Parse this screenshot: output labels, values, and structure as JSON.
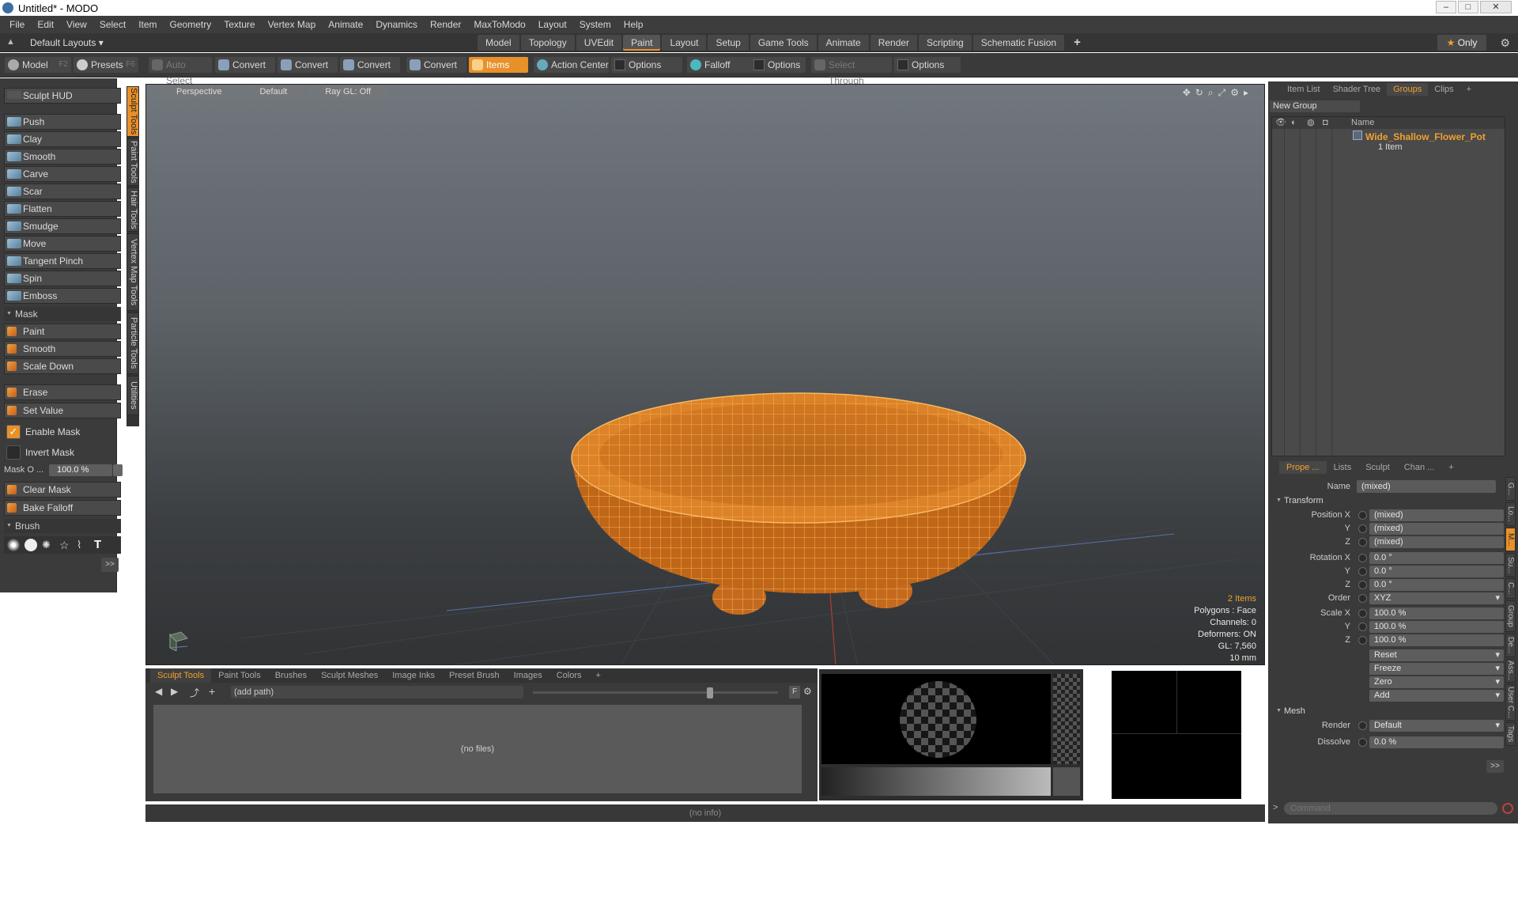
{
  "window": {
    "title": "Untitled* - MODO"
  },
  "menu": [
    "File",
    "Edit",
    "View",
    "Select",
    "Item",
    "Geometry",
    "Texture",
    "Vertex Map",
    "Animate",
    "Dynamics",
    "Render",
    "MaxToModo",
    "Layout",
    "System",
    "Help"
  ],
  "layoutbar": {
    "layout_name": "Default Layouts ▾",
    "tabs": [
      "Model",
      "Topology",
      "UVEdit",
      "Paint",
      "Layout",
      "Setup",
      "Game Tools",
      "Animate",
      "Render",
      "Scripting",
      "Schematic Fusion"
    ],
    "active_tab": "Paint",
    "plus": "+",
    "only_label": "Only"
  },
  "toolbar": {
    "model": "Model",
    "model_key": "F2",
    "presets": "Presets",
    "presets_key": "F6",
    "auto_select": "Auto Select",
    "convert1": "Convert",
    "convert2": "Convert",
    "convert3": "Convert",
    "convert4": "Convert",
    "items": "Items",
    "action_center": "Action Center",
    "options1": "Options",
    "falloff": "Falloff",
    "options2": "Options",
    "select_through": "Select Through",
    "options3": "Options"
  },
  "left": {
    "sculpt_hud": "Sculpt HUD",
    "tools": [
      "Push",
      "Clay",
      "Smooth",
      "Carve",
      "Scar",
      "Flatten",
      "Smudge",
      "Move",
      "Tangent Pinch",
      "Spin",
      "Emboss"
    ],
    "mask_section": "Mask",
    "mask_tools": [
      "Paint",
      "Smooth",
      "Scale Down"
    ],
    "erase": "Erase",
    "set_value": "Set Value",
    "enable_mask": "Enable Mask",
    "invert_mask": "Invert Mask",
    "mask_opacity_label": "Mask O ...",
    "mask_opacity_value": "100.0 %",
    "clear_mask": "Clear Mask",
    "bake_falloff": "Bake Falloff",
    "brush_section": "Brush",
    "more": ">>",
    "vtabs": [
      "Sculpt Tools",
      "Paint Tools",
      "Hair Tools",
      "Vertex Map Tools",
      "Particle Tools",
      "Utilities"
    ]
  },
  "viewport": {
    "view": "Perspective",
    "style": "Default",
    "raygl": "Ray GL: Off",
    "stats": {
      "items": "2 Items",
      "polygons": "Polygons : Face",
      "channels": "Channels: 0",
      "deformers": "Deformers: ON",
      "gl": "GL: 7,560",
      "scale": "10 mm"
    }
  },
  "browser": {
    "tabs": [
      "Sculpt Tools",
      "Paint Tools",
      "Brushes",
      "Sculpt Meshes",
      "Image Inks",
      "Preset Brush",
      "Images",
      "Colors",
      "+"
    ],
    "active_tab": "Sculpt Tools",
    "path": "(add path)",
    "empty": "(no files)",
    "f_label": "F"
  },
  "infobar": {
    "text": "(no info)"
  },
  "right": {
    "top_tabs": [
      "Item List",
      "Shader Tree",
      "Groups",
      "Clips",
      "+"
    ],
    "active_top_tab": "Groups",
    "new_group": "New Group",
    "col_name": "Name",
    "group_name": "Wide_Shallow_Flower_Pot",
    "group_count": "1 Item",
    "prop_tabs": [
      "Prope ...",
      "Lists",
      "Sculpt",
      "Chan ...",
      "+"
    ],
    "active_prop_tab": "Prope ...",
    "name_label": "Name",
    "name_value": "(mixed)",
    "transform": "Transform",
    "position_x_label": "Position X",
    "position_x": "(mixed)",
    "position_y_label": "Y",
    "position_y": "(mixed)",
    "position_z_label": "Z",
    "position_z": "(mixed)",
    "rotation_x_label": "Rotation X",
    "rotation_x": "0.0 °",
    "rotation_y_label": "Y",
    "rotation_y": "0.0 °",
    "rotation_z_label": "Z",
    "rotation_z": "0.0 °",
    "order_label": "Order",
    "order": "XYZ",
    "scale_x_label": "Scale X",
    "scale_x": "100.0 %",
    "scale_y_label": "Y",
    "scale_y": "100.0 %",
    "scale_z_label": "Z",
    "scale_z": "100.0 %",
    "reset": "Reset",
    "freeze": "Freeze",
    "zero": "Zero",
    "add": "Add",
    "mesh": "Mesh",
    "render_label": "Render",
    "render": "Default",
    "dissolve_label": "Dissolve",
    "dissolve": "0.0 %",
    "more": ">>",
    "side_tabs": [
      "G...",
      "Lo...",
      "M...",
      "Su...",
      "C...",
      "Group",
      "De...",
      "Ass...",
      "User C...",
      "Tags"
    ],
    "command_prompt": ">",
    "command_placeholder": "Command"
  },
  "colors": {
    "accent": "#e8902a",
    "wire": "#f5a340",
    "mesh_fill": "#c26a1e"
  }
}
